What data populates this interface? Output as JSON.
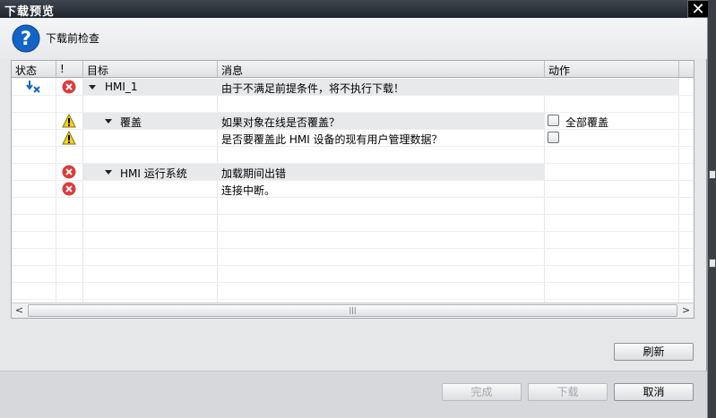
{
  "window": {
    "title": "下载预览",
    "close_glyph": "✕"
  },
  "header": {
    "title": "下载前检查",
    "icon": "question-icon"
  },
  "columns": {
    "status": "状态",
    "bang": "!",
    "target": "目标",
    "message": "消息",
    "action": "动作"
  },
  "rows": [
    {
      "target": "HMI_1",
      "message": "由于不满足前提条件，将不执行下载！",
      "action": ""
    },
    {
      "target": "覆盖",
      "message": "如果对象在线是否覆盖？",
      "action": "全部覆盖",
      "checked": false
    },
    {
      "target": "",
      "message": "是否要覆盖此 HMI 设备的现有用户管理数据？",
      "action": "",
      "checked": false
    },
    {
      "target": "HMI 运行系统",
      "message": "加载期间出错",
      "action": ""
    },
    {
      "target": "",
      "message": "连接中断。",
      "action": ""
    }
  ],
  "scroll": {
    "left": "<",
    "right": ">",
    "grip": "|||"
  },
  "buttons": {
    "refresh": "刷新",
    "finish": "完成",
    "download": "下载",
    "cancel": "取消"
  },
  "colors": {
    "error": "#e03a3a",
    "warning": "#f2d21f",
    "accent": "#1464c8"
  }
}
